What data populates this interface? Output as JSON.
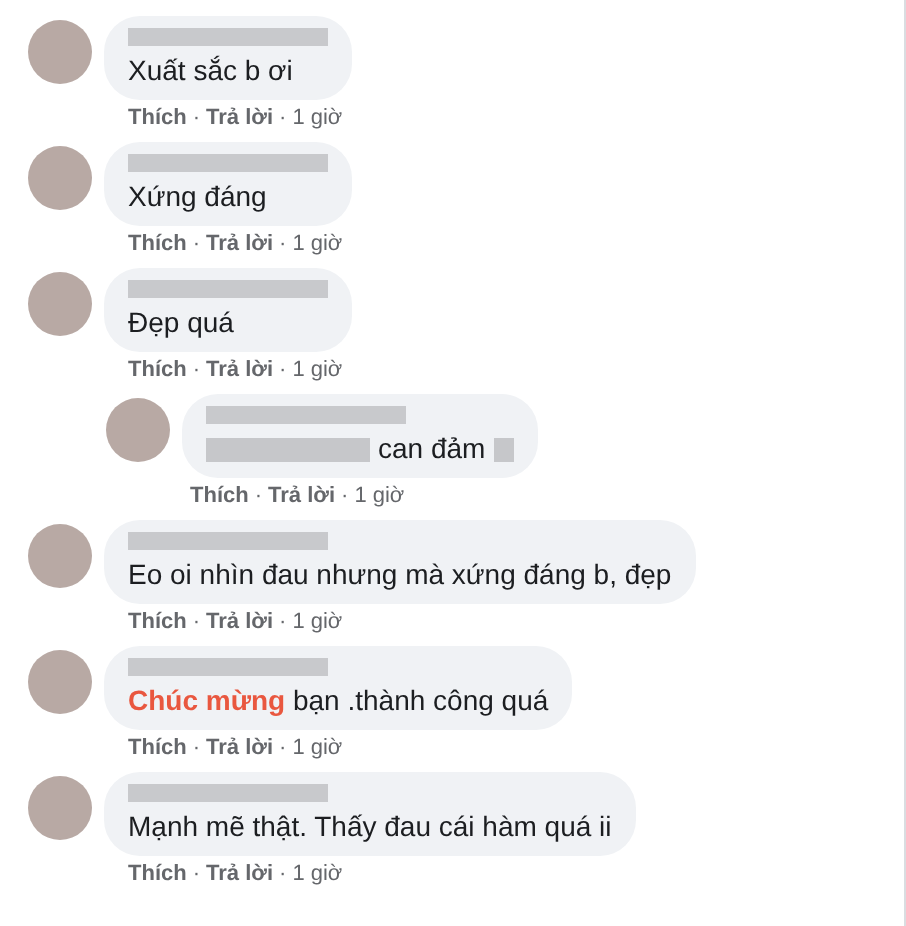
{
  "comments": [
    {
      "kind": "comment",
      "text": "Xuất sắc b ơi",
      "actions": {
        "like": "Thích",
        "reply": "Trả lời",
        "time": "1 giờ",
        "separator": "·"
      }
    },
    {
      "kind": "comment",
      "text": "Xứng đáng",
      "actions": {
        "like": "Thích",
        "reply": "Trả lời",
        "time": "1 giờ",
        "separator": "·"
      }
    },
    {
      "kind": "comment",
      "text": "Đẹp quá",
      "actions": {
        "like": "Thích",
        "reply": "Trả lời",
        "time": "1 giờ",
        "separator": "·"
      }
    },
    {
      "kind": "reply",
      "redacted_before": true,
      "text": "can đảm",
      "redacted_after": true,
      "actions": {
        "like": "Thích",
        "reply": "Trả lời",
        "time": "1 giờ",
        "separator": "·"
      }
    },
    {
      "kind": "comment",
      "text": "Eo oi nhìn đau nhưng mà xứng đáng b, đẹp",
      "actions": {
        "like": "Thích",
        "reply": "Trả lời",
        "time": "1 giờ",
        "separator": "·"
      }
    },
    {
      "kind": "comment",
      "highlight": "Chúc mừng",
      "text": "bạn .thành công quá",
      "actions": {
        "like": "Thích",
        "reply": "Trả lời",
        "time": "1 giờ",
        "separator": "·"
      }
    },
    {
      "kind": "comment",
      "text": "Mạnh mẽ thật. Thấy đau cái hàm quá ii",
      "actions": {
        "like": "Thích",
        "reply": "Trả lời",
        "time": "1 giờ",
        "separator": "·"
      }
    }
  ]
}
